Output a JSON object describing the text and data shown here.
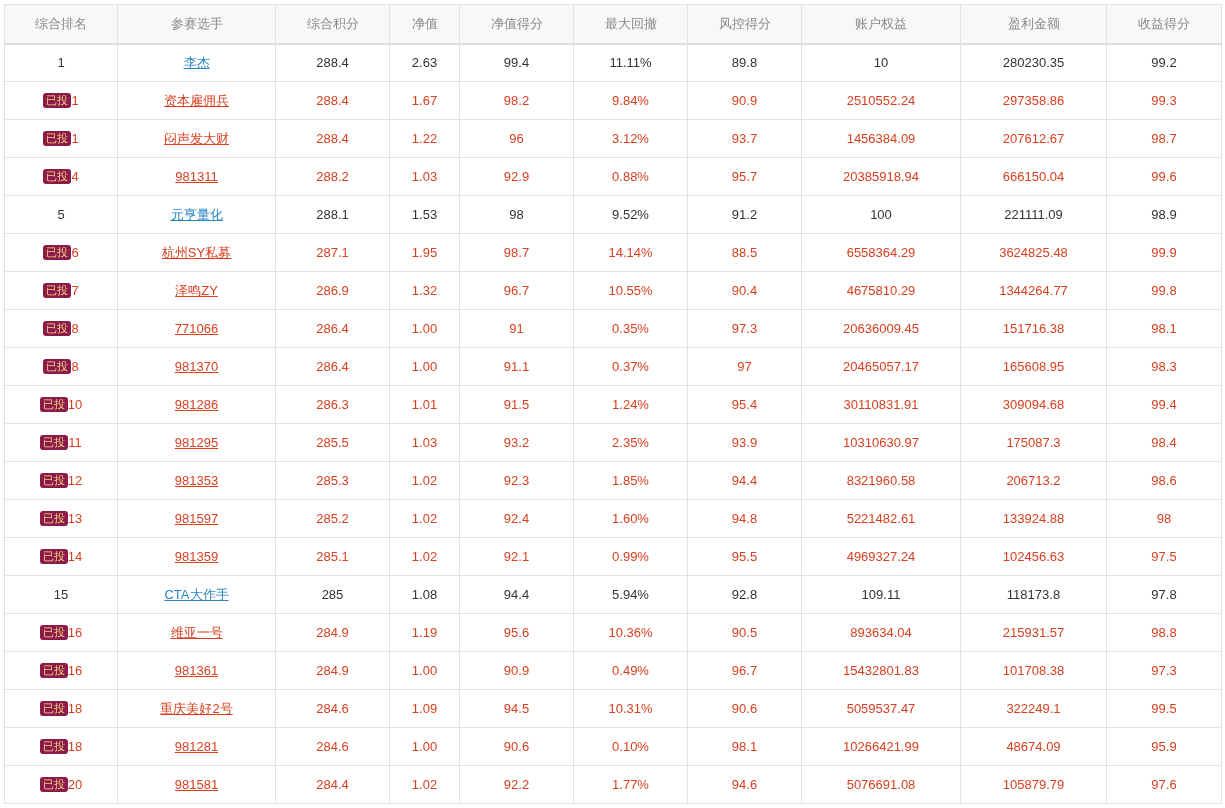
{
  "table": {
    "columns": [
      "综合排名",
      "参赛选手",
      "综合积分",
      "净值",
      "净值得分",
      "最大回撤",
      "风控得分",
      "账户权益",
      "盈利金额",
      "收益得分"
    ],
    "rows": [
      {
        "invested": false,
        "cells": [
          "1",
          "李杰",
          "288.4",
          "2.63",
          "99.4",
          "11.11%",
          "89.8",
          "10",
          "280230.35",
          "99.2"
        ]
      },
      {
        "invested": true,
        "badge": "已投",
        "cells": [
          "1",
          "资本雇佣兵",
          "288.4",
          "1.67",
          "98.2",
          "9.84%",
          "90.9",
          "2510552.24",
          "297358.86",
          "99.3"
        ]
      },
      {
        "invested": true,
        "badge": "已投",
        "cells": [
          "1",
          "闷声发大财",
          "288.4",
          "1.22",
          "96",
          "3.12%",
          "93.7",
          "1456384.09",
          "207612.67",
          "98.7"
        ]
      },
      {
        "invested": true,
        "badge": "已投",
        "cells": [
          "4",
          "981311",
          "288.2",
          "1.03",
          "92.9",
          "0.88%",
          "95.7",
          "20385918.94",
          "666150.04",
          "99.6"
        ]
      },
      {
        "invested": false,
        "cells": [
          "5",
          "元亨量化",
          "288.1",
          "1.53",
          "98",
          "9.52%",
          "91.2",
          "100",
          "221111.09",
          "98.9"
        ]
      },
      {
        "invested": true,
        "badge": "已投",
        "cells": [
          "6",
          "杭州SY私募",
          "287.1",
          "1.95",
          "98.7",
          "14.14%",
          "88.5",
          "6558364.29",
          "3624825.48",
          "99.9"
        ]
      },
      {
        "invested": true,
        "badge": "已投",
        "cells": [
          "7",
          "泽鸣ZY",
          "286.9",
          "1.32",
          "96.7",
          "10.55%",
          "90.4",
          "4675810.29",
          "1344264.77",
          "99.8"
        ]
      },
      {
        "invested": true,
        "badge": "已投",
        "cells": [
          "8",
          "771066",
          "286.4",
          "1.00",
          "91",
          "0.35%",
          "97.3",
          "20636009.45",
          "151716.38",
          "98.1"
        ]
      },
      {
        "invested": true,
        "badge": "已投",
        "cells": [
          "8",
          "981370",
          "286.4",
          "1.00",
          "91.1",
          "0.37%",
          "97",
          "20465057.17",
          "165608.95",
          "98.3"
        ]
      },
      {
        "invested": true,
        "badge": "已投",
        "cells": [
          "10",
          "981286",
          "286.3",
          "1.01",
          "91.5",
          "1.24%",
          "95.4",
          "30110831.91",
          "309094.68",
          "99.4"
        ]
      },
      {
        "invested": true,
        "badge": "已投",
        "cells": [
          "11",
          "981295",
          "285.5",
          "1.03",
          "93.2",
          "2.35%",
          "93.9",
          "10310630.97",
          "175087.3",
          "98.4"
        ]
      },
      {
        "invested": true,
        "badge": "已投",
        "cells": [
          "12",
          "981353",
          "285.3",
          "1.02",
          "92.3",
          "1.85%",
          "94.4",
          "8321960.58",
          "206713.2",
          "98.6"
        ]
      },
      {
        "invested": true,
        "badge": "已投",
        "cells": [
          "13",
          "981597",
          "285.2",
          "1.02",
          "92.4",
          "1.60%",
          "94.8",
          "5221482.61",
          "133924.88",
          "98"
        ]
      },
      {
        "invested": true,
        "badge": "已投",
        "cells": [
          "14",
          "981359",
          "285.1",
          "1.02",
          "92.1",
          "0.99%",
          "95.5",
          "4969327.24",
          "102456.63",
          "97.5"
        ]
      },
      {
        "invested": false,
        "cells": [
          "15",
          "CTA大作手",
          "285",
          "1.08",
          "94.4",
          "5.94%",
          "92.8",
          "109.11",
          "118173.8",
          "97.8"
        ]
      },
      {
        "invested": true,
        "badge": "已投",
        "cells": [
          "16",
          "维亚一号",
          "284.9",
          "1.19",
          "95.6",
          "10.36%",
          "90.5",
          "893634.04",
          "215931.57",
          "98.8"
        ]
      },
      {
        "invested": true,
        "badge": "已投",
        "cells": [
          "16",
          "981361",
          "284.9",
          "1.00",
          "90.9",
          "0.49%",
          "96.7",
          "15432801.83",
          "101708.38",
          "97.3"
        ]
      },
      {
        "invested": true,
        "badge": "已投",
        "cells": [
          "18",
          "重庆美好2号",
          "284.6",
          "1.09",
          "94.5",
          "10.31%",
          "90.6",
          "5059537.47",
          "322249.1",
          "99.5"
        ]
      },
      {
        "invested": true,
        "badge": "已投",
        "cells": [
          "18",
          "981281",
          "284.6",
          "1.00",
          "90.6",
          "0.10%",
          "98.1",
          "10266421.99",
          "48674.09",
          "95.9"
        ]
      },
      {
        "invested": true,
        "badge": "已投",
        "cells": [
          "20",
          "981581",
          "284.4",
          "1.02",
          "92.2",
          "1.77%",
          "94.6",
          "5076691.08",
          "105879.79",
          "97.6"
        ]
      }
    ]
  }
}
